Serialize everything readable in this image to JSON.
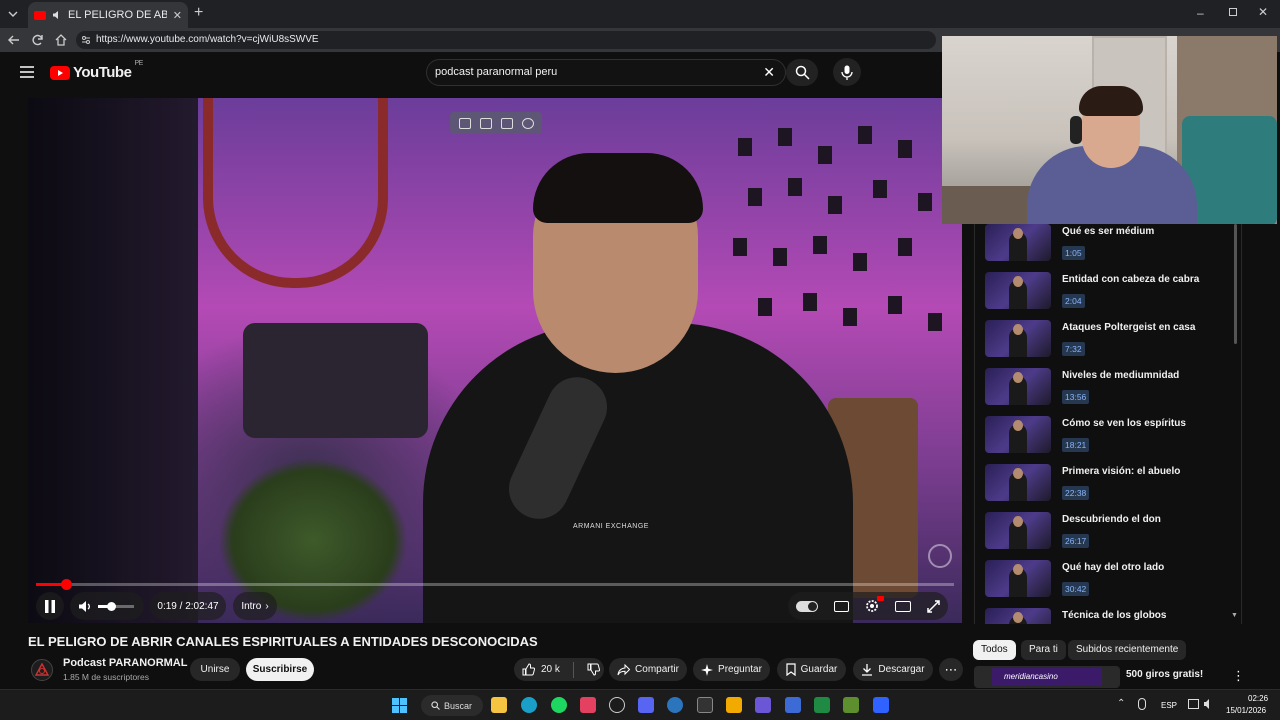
{
  "browser": {
    "tab_title": "EL PELIGRO DE ABRIR CANALES",
    "url": "https://www.youtube.com/watch?v=cjWiU8sSWVE"
  },
  "header": {
    "logo": "YouTube",
    "country": "PE",
    "search_value": "podcast  paranormal peru"
  },
  "player": {
    "time_current": "0:19",
    "time_sep": " / ",
    "time_total": "2:02:47",
    "chapter": "Intro",
    "progress_fraction": 0.0026,
    "volume_fraction": 0.35,
    "overlay_text": "ARMANI EXCHANGE"
  },
  "video": {
    "title": "EL PELIGRO DE ABRIR CANALES ESPIRITUALES A ENTIDADES DESCONOCIDAS",
    "channel": "Podcast PARANORMAL",
    "subscribers": "1.85 M de suscriptores",
    "join_label": "Unirse",
    "subscribe_label": "Suscribirse",
    "likes": "20 k",
    "share_label": "Compartir",
    "ask_label": "Preguntar",
    "save_label": "Guardar",
    "download_label": "Descargar"
  },
  "playlist": [
    {
      "title": "Qué es ser médium",
      "time": "1:05"
    },
    {
      "title": "Entidad con cabeza de cabra",
      "time": "2:04"
    },
    {
      "title": "Ataques Poltergeist en casa",
      "time": "7:32"
    },
    {
      "title": "Niveles de mediumnidad",
      "time": "13:56"
    },
    {
      "title": "Cómo se ven los espíritus",
      "time": "18:21"
    },
    {
      "title": "Primera visión: el abuelo",
      "time": "22:38"
    },
    {
      "title": "Descubriendo el don",
      "time": "26:17"
    },
    {
      "title": "Qué hay del otro lado",
      "time": "30:42"
    },
    {
      "title": "Técnica de los globos",
      "time": ""
    }
  ],
  "chips": [
    "Todos",
    "Para ti",
    "Subidos recientemente"
  ],
  "ad": {
    "brand": "meridiancasino",
    "text": "500 giros gratis!"
  },
  "taskbar": {
    "search_label": "Buscar",
    "lang": "ESP",
    "time": "02:26",
    "date": "15/01/2026"
  },
  "colors": {
    "accent_red": "#ff0000",
    "chapter_blue": "#8ab4f8",
    "background": "#0f0f0f"
  }
}
